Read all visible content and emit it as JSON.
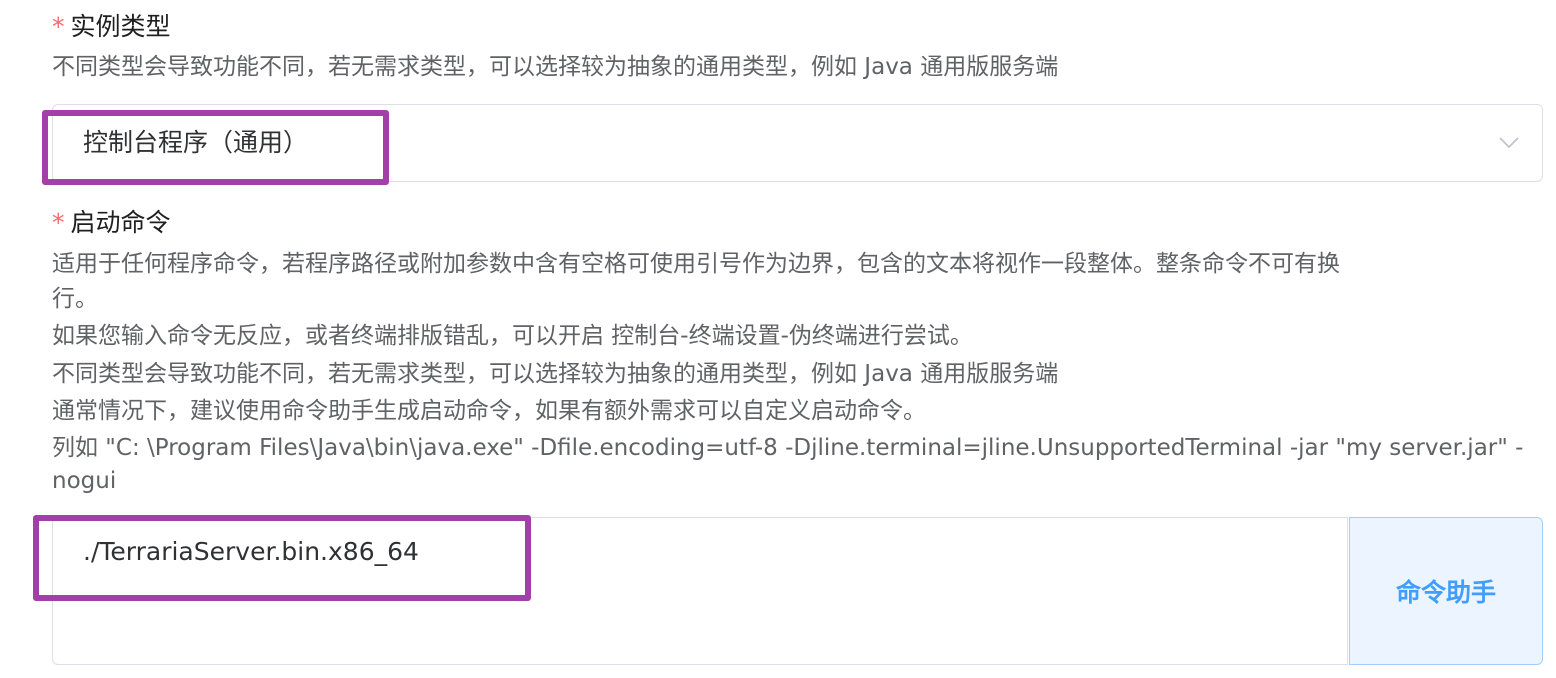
{
  "instance_type": {
    "required_mark": "*",
    "label": "实例类型",
    "description": "不同类型会导致功能不同，若无需求类型，可以选择较为抽象的通用类型，例如 Java 通用版服务端",
    "selected_value": "控制台程序（通用）",
    "dropdown_icon": "chevron-down-icon"
  },
  "start_command": {
    "required_mark": "*",
    "label": "启动命令",
    "description_lines": [
      "适用于任何程序命令，若程序路径或附加参数中含有空格可使用引号作为边界，包含的文本将视作一段整体。整条命令不可有换",
      "行。",
      "如果您输入命令无反应，或者终端排版错乱，可以开启 控制台-终端设置-伪终端进行尝试。",
      "不同类型会导致功能不同，若无需求类型，可以选择较为抽象的通用类型，例如 Java 通用版服务端",
      "通常情况下，建议使用命令助手生成启动命令，如果有额外需求可以自定义启动命令。",
      "列如 \"C: \\Program Files\\Java\\bin\\java.exe\" -Dfile.encoding=utf-8 -Djline.terminal=jline.UnsupportedTerminal -jar \"my server.jar\" -",
      "nogui"
    ],
    "value": "./TerrariaServer.bin.x86_64",
    "helper_button_label": "命令助手"
  },
  "colors": {
    "required": "#f56c6c",
    "highlight": "#a33fa8",
    "button_text": "#409eff",
    "button_bg": "#ecf5ff",
    "border": "#dcdfe6"
  }
}
